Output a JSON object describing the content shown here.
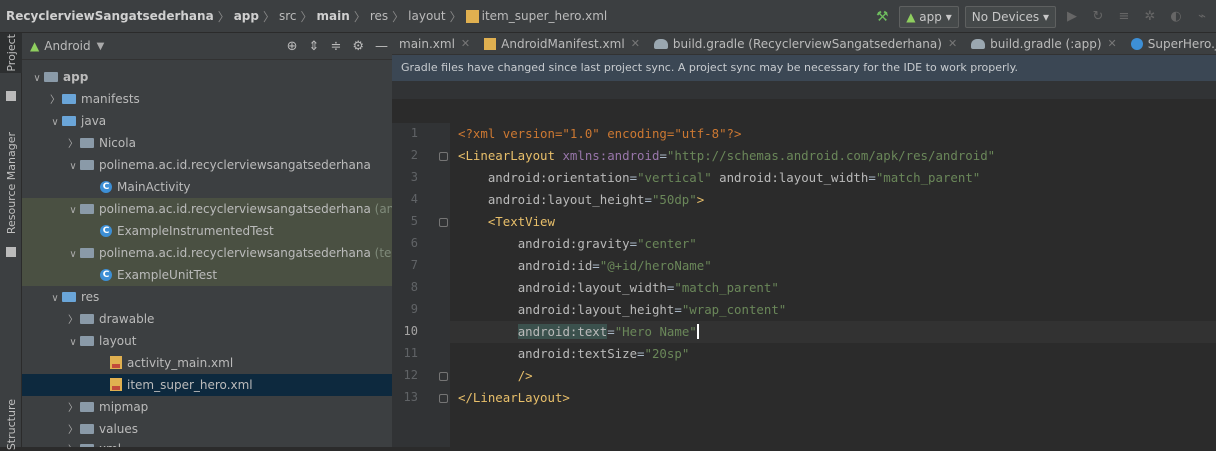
{
  "breadcrumbs": {
    "project": "RecyclerviewSangatsederhana",
    "items": [
      "app",
      "src",
      "main",
      "res",
      "layout"
    ],
    "file": "item_super_hero.xml"
  },
  "toolbar": {
    "config": "app",
    "device": "No Devices"
  },
  "left_tabs": [
    "Project",
    "Resource Manager",
    "Structure"
  ],
  "project_panel": {
    "view_mode": "Android"
  },
  "tree": [
    {
      "label": "app",
      "arrow": "v"
    },
    {
      "label": "manifests",
      "arrow": ">"
    },
    {
      "label": "java",
      "arrow": "v"
    },
    {
      "label": "Nicola",
      "arrow": ">"
    },
    {
      "label": "polinema.ac.id.recyclerviewsangatsederhana",
      "arrow": "v"
    },
    {
      "label": "MainActivity"
    },
    {
      "label": "polinema.ac.id.recyclerviewsangatsederhana",
      "suffix": "(and",
      "arrow": "v"
    },
    {
      "label": "ExampleInstrumentedTest"
    },
    {
      "label": "polinema.ac.id.recyclerviewsangatsederhana",
      "suffix": "(test",
      "arrow": "v"
    },
    {
      "label": "ExampleUnitTest"
    },
    {
      "label": "res",
      "arrow": "v"
    },
    {
      "label": "drawable",
      "arrow": ">"
    },
    {
      "label": "layout",
      "arrow": "v"
    },
    {
      "label": "activity_main.xml"
    },
    {
      "label": "item_super_hero.xml"
    },
    {
      "label": "mipmap",
      "arrow": ">"
    },
    {
      "label": "values",
      "arrow": ">"
    },
    {
      "label": "xml",
      "arrow": ">"
    }
  ],
  "editor_tabs": [
    "main.xml",
    "AndroidManifest.xml",
    "build.gradle (RecyclerviewSangatsederhana)",
    "build.gradle (:app)",
    "SuperHero.java"
  ],
  "banner": "Gradle files have changed since last project sync. A project sync may be necessary for the IDE to work properly.",
  "code": {
    "line_numbers": [
      "1",
      "2",
      "3",
      "4",
      "5",
      "6",
      "7",
      "8",
      "9",
      "10",
      "11",
      "12",
      "13"
    ],
    "l1_decl": "<?xml version=\"1.0\" encoding=\"utf-8\"?>",
    "l2_tag": "<LinearLayout",
    "l2_ns": "xmlns:android",
    "l2_val": "\"http://schemas.android.com/apk/res/android\"",
    "l3_a1": "android:orientation",
    "l3_v1": "\"vertical\"",
    "l3_a2": "android:layout_width",
    "l3_v2": "\"match_parent\"",
    "l4_a": "android:layout_height",
    "l4_v": "\"50dp\"",
    "l4_end": ">",
    "l5_tag": "<TextView",
    "l6_a": "android:gravity",
    "l6_v": "\"center\"",
    "l7_a": "android:id",
    "l7_v": "\"@+id/heroName\"",
    "l8_a": "android:layout_width",
    "l8_v": "\"match_parent\"",
    "l9_a": "android:layout_height",
    "l9_v": "\"wrap_content\"",
    "l10_a": "android:text",
    "l10_v": "\"Hero Name\"",
    "l11_a": "android:textSize",
    "l11_v": "\"20sp\"",
    "l12": "/>",
    "l13": "</LinearLayout>"
  }
}
